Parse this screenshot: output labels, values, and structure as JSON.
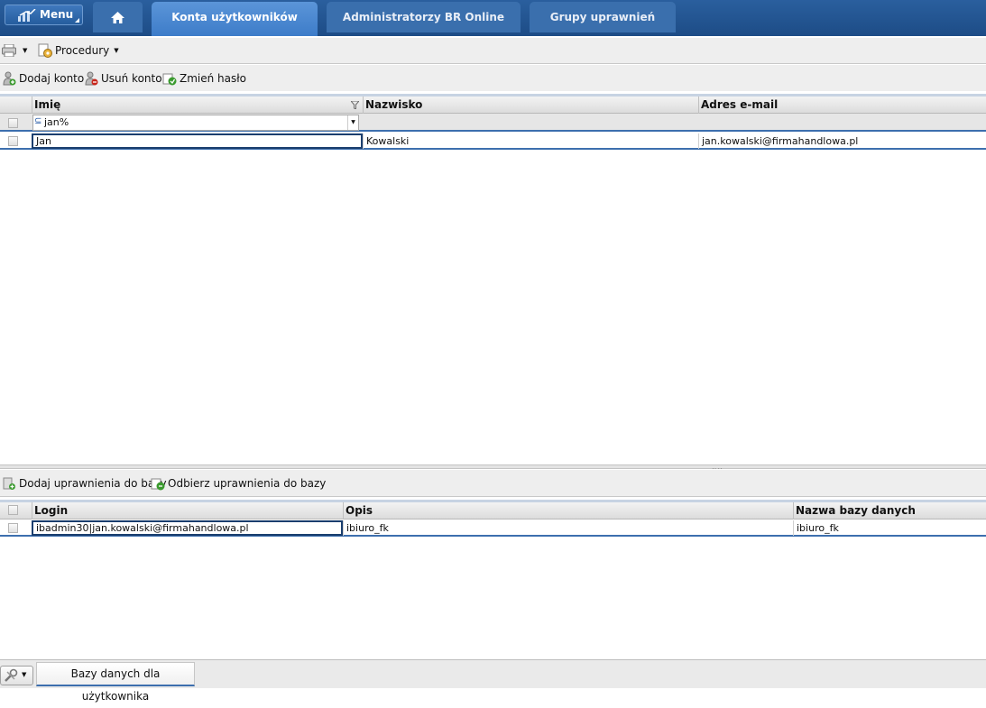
{
  "topbar": {
    "menu_label": "Menu",
    "tabs": [
      {
        "label": "Konta użytkowników",
        "active": true
      },
      {
        "label": "Administratorzy BR Online",
        "active": false
      },
      {
        "label": "Grupy uprawnień",
        "active": false
      }
    ]
  },
  "toolbar1": {
    "procedures_label": "Procedury"
  },
  "toolbar2": {
    "add_account": "Dodaj konto",
    "remove_account": "Usuń konto",
    "change_password": "Zmień hasło"
  },
  "accounts_grid": {
    "columns": [
      "Imię",
      "Nazwisko",
      "Adres e-mail"
    ],
    "filter_value": "jan%",
    "rows": [
      {
        "first_name": "Jan",
        "last_name": "Kowalski",
        "email": "jan.kowalski@firmahandlowa.pl"
      }
    ]
  },
  "toolbar3": {
    "add_db_rights": "Dodaj uprawnienia do bazy",
    "remove_db_rights": "Odbierz uprawnienia do bazy"
  },
  "db_grid": {
    "columns": [
      "Login",
      "Opis",
      "Nazwa bazy danych"
    ],
    "rows": [
      {
        "login": "ibadmin30|jan.kowalski@firmahandlowa.pl",
        "description": "ibiuro_fk",
        "db_name": "ibiuro_fk"
      }
    ]
  },
  "bottom_tab": {
    "label": "Bazy danych dla użytkownika"
  },
  "colors": {
    "header_blue": "#1d4c86",
    "active_tab": "#4a86cf",
    "selection_border": "#3d6fae"
  }
}
